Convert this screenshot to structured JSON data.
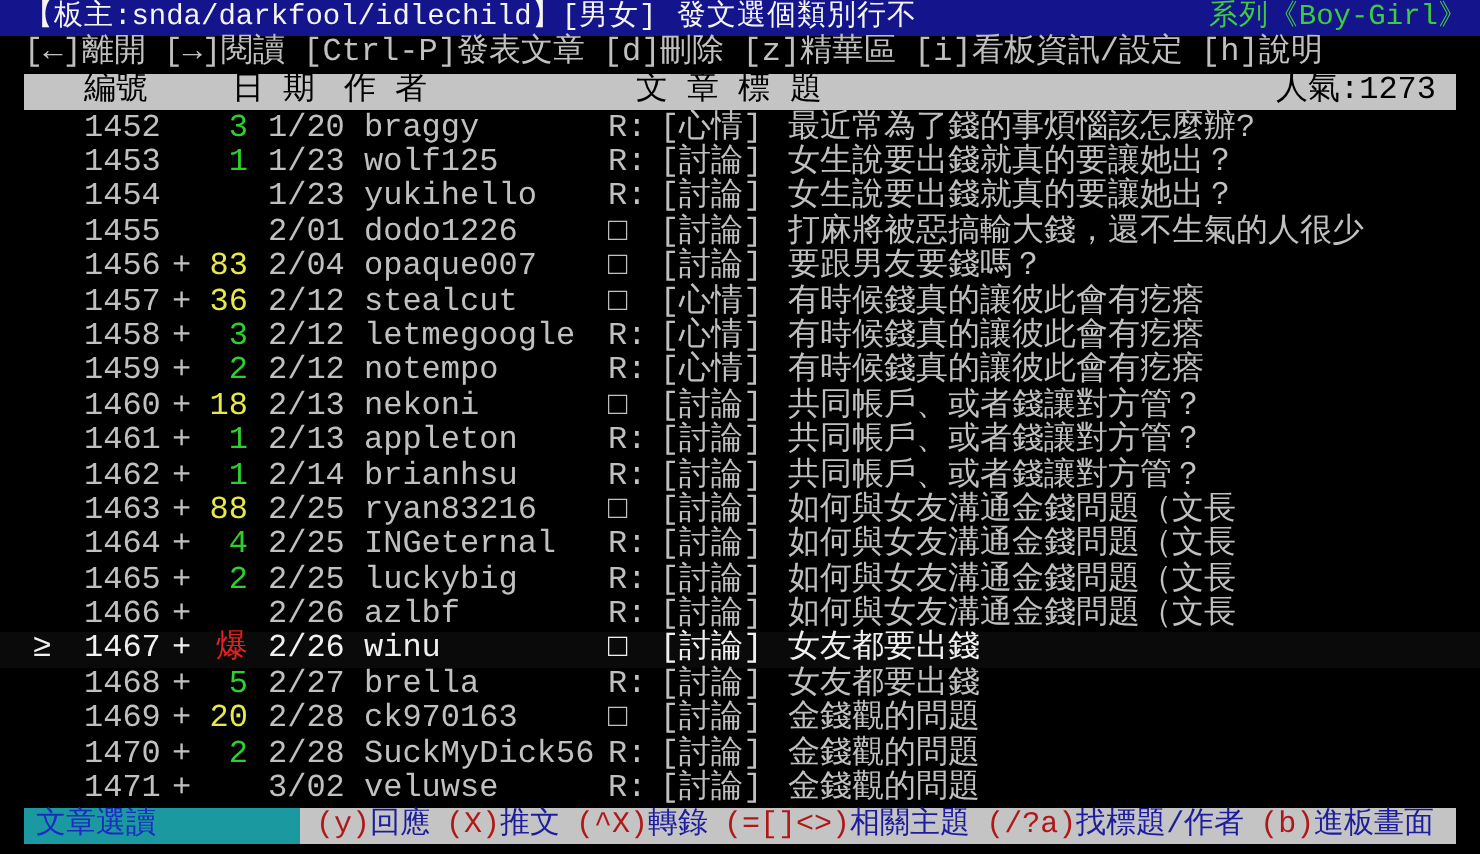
{
  "title_bar": {
    "moderators": "【板主:snda/darkfool/idlechild】",
    "board": "[男女]",
    "motto": "發文選個類別行不",
    "series": "系列《Boy-Girl》"
  },
  "key_hints": [
    "[←]離開",
    "[→]閱讀",
    "[Ctrl-P]發表文章",
    "[d]刪除",
    "[z]精華區",
    "[i]看板資訊/設定",
    "[h]說明"
  ],
  "columns": {
    "number": "編號",
    "date": "日 期",
    "author": "作 者",
    "title": "文 章 標 題",
    "popularity": "人氣:1273"
  },
  "cursor": "≥",
  "posts": [
    {
      "number": "1452",
      "push": "3",
      "color": "#2ed02e",
      "date": "1/20",
      "author": "braggy",
      "mark": "R:",
      "category": "[心情]",
      "title": "最近常為了錢的事煩惱該怎麼辦?",
      "selected": false
    },
    {
      "number": "1453",
      "push": "1",
      "color": "#2ed02e",
      "date": "1/23",
      "author": "wolf125",
      "mark": "R:",
      "category": "[討論]",
      "title": "女生說要出錢就真的要讓她出？",
      "selected": false
    },
    {
      "number": "1454",
      "date": "1/23",
      "author": "yukihello",
      "mark": "R:",
      "category": "[討論]",
      "title": "女生說要出錢就真的要讓她出？",
      "selected": false
    },
    {
      "number": "1455",
      "date": "2/01",
      "author": "dodo1226",
      "mark": "□",
      "category": "[討論]",
      "title": "打麻將被惡搞輸大錢，還不生氣的人很少",
      "selected": false
    },
    {
      "number": "1456",
      "plus": "+",
      "push": "83",
      "color": "#e8e84a",
      "date": "2/04",
      "author": "opaque007",
      "mark": "□",
      "category": "[討論]",
      "title": "要跟男友要錢嗎？",
      "selected": false
    },
    {
      "number": "1457",
      "plus": "+",
      "push": "36",
      "color": "#e8e84a",
      "date": "2/12",
      "author": "stealcut",
      "mark": "□",
      "category": "[心情]",
      "title": "有時候錢真的讓彼此會有疙瘩",
      "selected": false
    },
    {
      "number": "1458",
      "plus": "+",
      "push": "3",
      "color": "#2ed02e",
      "date": "2/12",
      "author": "letmegoogle",
      "mark": "R:",
      "category": "[心情]",
      "title": "有時候錢真的讓彼此會有疙瘩",
      "selected": false
    },
    {
      "number": "1459",
      "plus": "+",
      "push": "2",
      "color": "#2ed02e",
      "date": "2/12",
      "author": "notempo",
      "mark": "R:",
      "category": "[心情]",
      "title": "有時候錢真的讓彼此會有疙瘩",
      "selected": false
    },
    {
      "number": "1460",
      "plus": "+",
      "push": "18",
      "color": "#e8e84a",
      "date": "2/13",
      "author": "nekoni",
      "mark": "□",
      "category": "[討論]",
      "title": "共同帳戶、或者錢讓對方管？",
      "selected": false
    },
    {
      "number": "1461",
      "plus": "+",
      "push": "1",
      "color": "#2ed02e",
      "date": "2/13",
      "author": "appleton",
      "mark": "R:",
      "category": "[討論]",
      "title": "共同帳戶、或者錢讓對方管？",
      "selected": false
    },
    {
      "number": "1462",
      "plus": "+",
      "push": "1",
      "color": "#2ed02e",
      "date": "2/14",
      "author": "brianhsu",
      "mark": "R:",
      "category": "[討論]",
      "title": "共同帳戶、或者錢讓對方管？",
      "selected": false
    },
    {
      "number": "1463",
      "plus": "+",
      "push": "88",
      "color": "#e8e84a",
      "date": "2/25",
      "author": "ryan83216",
      "mark": "□",
      "category": "[討論]",
      "title": "如何與女友溝通金錢問題（文長",
      "selected": false
    },
    {
      "number": "1464",
      "plus": "+",
      "push": "4",
      "color": "#2ed02e",
      "date": "2/25",
      "author": "INGeternal",
      "mark": "R:",
      "category": "[討論]",
      "title": "如何與女友溝通金錢問題（文長",
      "selected": false
    },
    {
      "number": "1465",
      "plus": "+",
      "push": "2",
      "color": "#2ed02e",
      "date": "2/25",
      "author": "luckybig",
      "mark": "R:",
      "category": "[討論]",
      "title": "如何與女友溝通金錢問題（文長",
      "selected": false
    },
    {
      "number": "1466",
      "plus": "+",
      "date": "2/26",
      "author": "azlbf",
      "mark": "R:",
      "category": "[討論]",
      "title": "如何與女友溝通金錢問題（文長",
      "selected": false
    },
    {
      "number": "1467",
      "plus": "+",
      "push": "爆",
      "color": "#e02020",
      "date": "2/26",
      "author": "winu",
      "mark": "□",
      "category": "[討論]",
      "title": "女友都要出錢",
      "selected": true
    },
    {
      "number": "1468",
      "plus": "+",
      "push": "5",
      "color": "#2ed02e",
      "date": "2/27",
      "author": "brella",
      "mark": "R:",
      "category": "[討論]",
      "title": "女友都要出錢",
      "selected": false
    },
    {
      "number": "1469",
      "plus": "+",
      "push": "20",
      "color": "#e8e84a",
      "date": "2/28",
      "author": "ck970163",
      "mark": "□",
      "category": "[討論]",
      "title": "金錢觀的問題",
      "selected": false
    },
    {
      "number": "1470",
      "plus": "+",
      "push": "2",
      "color": "#2ed02e",
      "date": "2/28",
      "author": "SuckMyDick56",
      "mark": "R:",
      "category": "[討論]",
      "title": "金錢觀的問題",
      "selected": false
    },
    {
      "number": "1471",
      "plus": "+",
      "date": "3/02",
      "author": "veluwse",
      "mark": "R:",
      "category": "[討論]",
      "title": "金錢觀的問題",
      "selected": false
    }
  ],
  "footer": {
    "mode": "文章選讀",
    "commands": [
      {
        "key": "(y)",
        "label": "回應"
      },
      {
        "key": "(X)",
        "label": "推文"
      },
      {
        "key": "(^X)",
        "label": "轉錄"
      },
      {
        "key": "(=[]<>)",
        "label": "相關主題"
      },
      {
        "key": "(/?a)",
        "label": "找標題/作者"
      },
      {
        "key": "(b)",
        "label": "進板畫面"
      }
    ]
  }
}
